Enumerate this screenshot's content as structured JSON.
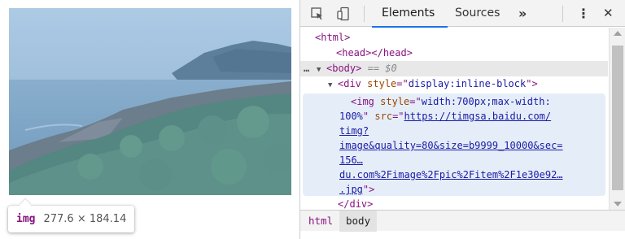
{
  "viewport": {
    "image_alt": "coastal cliff landscape with sea",
    "tooltip": {
      "tag": "img",
      "dimensions": "277.6 × 184.14"
    }
  },
  "devtools": {
    "toolbar": {
      "inspect_icon": "inspect-cursor-icon",
      "device_icon": "device-toolbar-icon",
      "tabs": [
        {
          "label": "Elements",
          "active": true
        },
        {
          "label": "Sources",
          "active": false
        }
      ],
      "more_tabs": "»",
      "menu_icon": "⋮",
      "close_icon": "✕"
    },
    "dom": {
      "html_open": "html",
      "head": "head",
      "head_close": "/head",
      "body": "body",
      "body_eq": "== $0",
      "div_tag": "div",
      "div_attr_name": "style",
      "div_attr_value": "display:inline-block",
      "img_tag": "img",
      "img_style_name": "style",
      "img_style_value_1": "width:700px;max-width:",
      "img_style_value_2": "100%",
      "img_src_name": "src",
      "img_src_1": "https://timgsa.baidu.com/",
      "img_src_2": "timg?",
      "img_src_3": "image&quality=80&size=b9999_10000&sec=",
      "img_src_4": "156…",
      "img_src_5": "du.com%2Fimage%2Fpic%2Fitem%2F1e30e92…",
      "img_src_6": ".jpg",
      "div_close": "/div",
      "ellipsis": "…"
    },
    "breadcrumbs": [
      "html",
      "body"
    ]
  }
}
